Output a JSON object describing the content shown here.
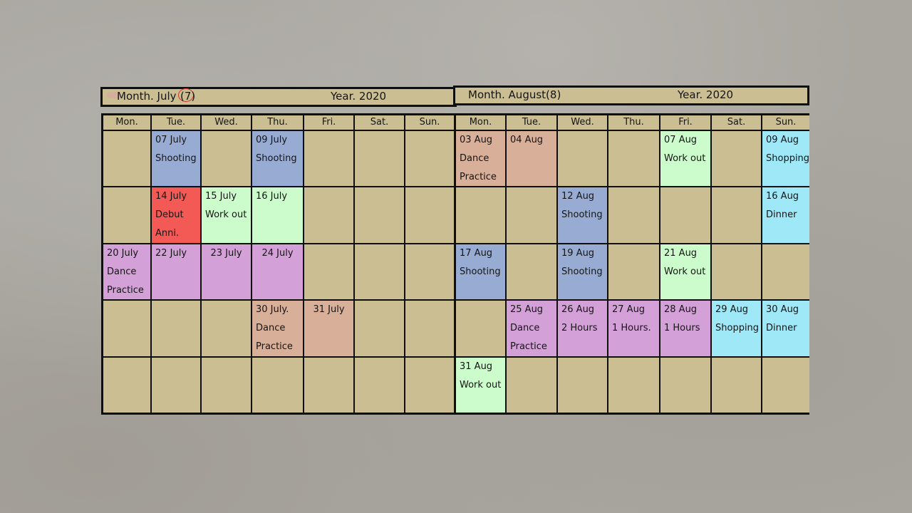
{
  "july_header": {
    "month_label": "Month. July",
    "month_number": "(7)",
    "year_label": "Year. 2020"
  },
  "august_header": {
    "month_label": "Month. August(8)",
    "year_label": "Year. 2020"
  },
  "july_weekdays": [
    "Mon.",
    "Tue.",
    "Wed.",
    "Thu.",
    "Fri.",
    "Sat.",
    "Sun."
  ],
  "august_weekdays": [
    "Mon.",
    "Tue.",
    "Wed.",
    "Thu.",
    "Fri.",
    "Sat.",
    "Sun."
  ],
  "july_events": {
    "d07": {
      "date": "07 July",
      "text": "Shooting",
      "color": "#98acd3"
    },
    "d09": {
      "date": "09 July",
      "text": "Shooting",
      "color": "#98acd3"
    },
    "d14": {
      "date": "14 July",
      "text": "Debut",
      "text2": "Anni.",
      "icon": "party-popper-icon",
      "color": "#f45a55"
    },
    "d15": {
      "date": "15 July",
      "text": "Work out",
      "color": "#ccfccc"
    },
    "d16": {
      "date": "16 July",
      "color": "#ccfccc"
    },
    "d20": {
      "date": "20 July",
      "text": "Dance",
      "text2": "Practice",
      "color": "#d3a0d8"
    },
    "d22": {
      "date": "22 July",
      "color": "#d3a0d8"
    },
    "d23": {
      "date": "23 July",
      "color": "#d3a0d8"
    },
    "d24": {
      "date": "24 July",
      "color": "#d3a0d8"
    },
    "d30": {
      "date": "30 July.",
      "text": "Dance",
      "text2": "Practice",
      "color": "#d8b09a"
    },
    "d31": {
      "date": "31 July",
      "color": "#d8b09a"
    }
  },
  "august_events": {
    "d03": {
      "date": "03 Aug",
      "text": "Dance",
      "text2": "Practice",
      "color": "#d8b09a"
    },
    "d04": {
      "date": "04 Aug",
      "color": "#d8b09a"
    },
    "d07": {
      "date": "07 Aug",
      "text": "Work out",
      "color": "#ccfccc"
    },
    "d09": {
      "date": "09 Aug",
      "text": "Shopping",
      "color": "#9ee8f7"
    },
    "d12": {
      "date": "12 Aug",
      "text": "Shooting",
      "color": "#98acd3"
    },
    "d16": {
      "date": "16 Aug",
      "text": "Dinner",
      "color": "#9ee8f7"
    },
    "d17": {
      "date": "17 Aug",
      "text": "Shooting",
      "color": "#98acd3"
    },
    "d19": {
      "date": "19 Aug",
      "text": "Shooting",
      "color": "#98acd3"
    },
    "d21": {
      "date": "21 Aug",
      "text": "Work out",
      "color": "#ccfccc"
    },
    "d25": {
      "date": "25 Aug",
      "text": "Dance",
      "text2": "Practice",
      "color": "#d3a0d8"
    },
    "d26": {
      "date": "26 Aug",
      "text": "2 Hours",
      "color": "#d3a0d8"
    },
    "d27": {
      "date": "27 Aug",
      "text": "1 Hours.",
      "color": "#d3a0d8"
    },
    "d28": {
      "date": "28 Aug",
      "text": "1 Hours",
      "color": "#d3a0d8"
    },
    "d29": {
      "date": "29 Aug",
      "text": "Shopping",
      "color": "#9ee8f7"
    },
    "d30": {
      "date": "30 Aug",
      "text": "Dinner",
      "color": "#9ee8f7"
    },
    "d31": {
      "date": "31 Aug",
      "text": "Work out",
      "color": "#ccfccc"
    }
  },
  "colors": {
    "paper": "#cbbe93",
    "border": "#0f0f0f",
    "background": "#aaa7a1",
    "circle_mark": "#d8332b"
  }
}
